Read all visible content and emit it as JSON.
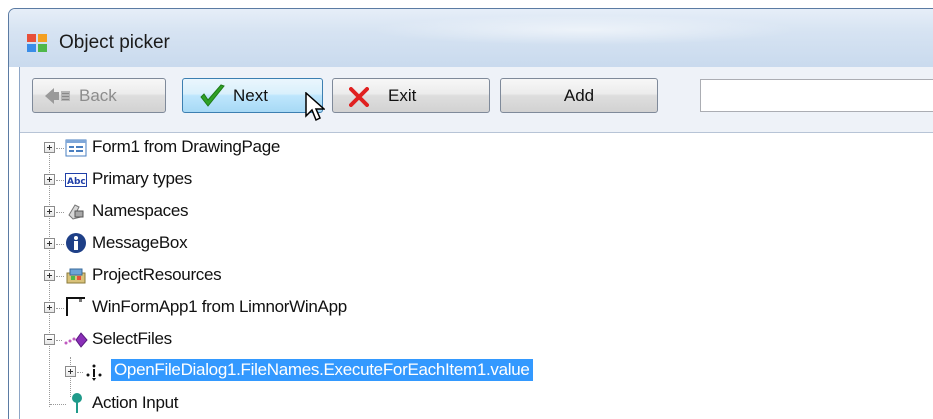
{
  "window": {
    "title": "Object picker"
  },
  "toolbar": {
    "back_label": "Back",
    "next_label": "Next",
    "exit_label": "Exit",
    "add_label": "Add",
    "search_value": ""
  },
  "tree": {
    "items": [
      {
        "label": "Form1 from DrawingPage",
        "icon": "form-icon",
        "expanded": false
      },
      {
        "label": "Primary types",
        "icon": "abc-type-icon",
        "expanded": false
      },
      {
        "label": "Namespaces",
        "icon": "namespace-icon",
        "expanded": false
      },
      {
        "label": "MessageBox",
        "icon": "info-icon",
        "expanded": false
      },
      {
        "label": "ProjectResources",
        "icon": "resources-icon",
        "expanded": false
      },
      {
        "label": "WinFormApp1 from LimnorWinApp",
        "icon": "winform-app-icon",
        "expanded": false
      },
      {
        "label": "SelectFiles",
        "icon": "method-icon",
        "expanded": true
      },
      {
        "label": "OpenFileDialog1.FileNames.ExecuteForEachItem1.value",
        "icon": "variable-icon",
        "expanded": false,
        "selected": true
      },
      {
        "label": "Action Input",
        "icon": "pin-icon",
        "expanded": false
      }
    ]
  },
  "colors": {
    "selection": "#3399ff",
    "title_bar": "#d6e3f2",
    "toolbar": "#eef2f8"
  }
}
